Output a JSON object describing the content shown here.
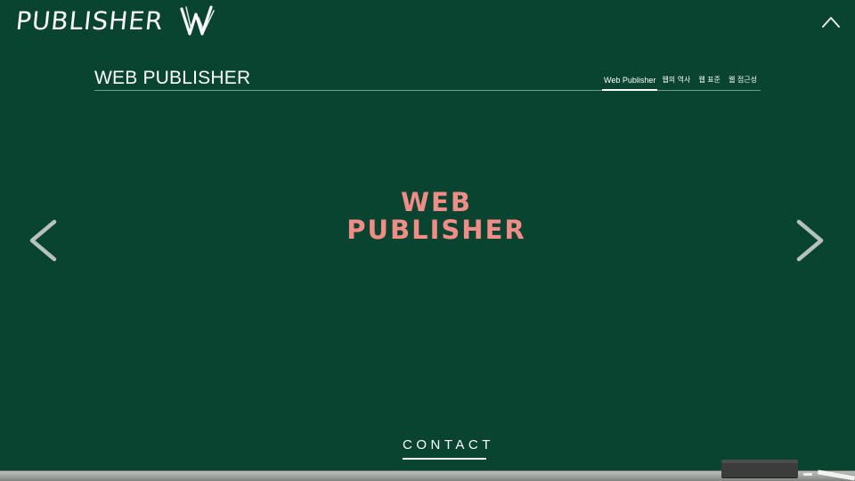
{
  "logo": {
    "text": "PUBLISHER",
    "mark_icon": "chalk-w-logo"
  },
  "top_button": {
    "icon": "chevron-up-icon"
  },
  "header": {
    "title": "WEB PUBLISHER",
    "nav": [
      {
        "label": "Web Publisher",
        "active": true
      },
      {
        "label": "웹의 역사",
        "active": false
      },
      {
        "label": "웹 표준",
        "active": false
      },
      {
        "label": "웹 접근성",
        "active": false
      }
    ]
  },
  "hero": {
    "line1": "WEB",
    "line2": "PUBLISHER"
  },
  "slider": {
    "prev_icon": "chevron-left-icon",
    "next_icon": "chevron-right-icon"
  },
  "contact": {
    "label": "CONTACT"
  },
  "colors": {
    "background": "#084430",
    "hero_text": "#f28c87",
    "text": "#ffffff"
  }
}
